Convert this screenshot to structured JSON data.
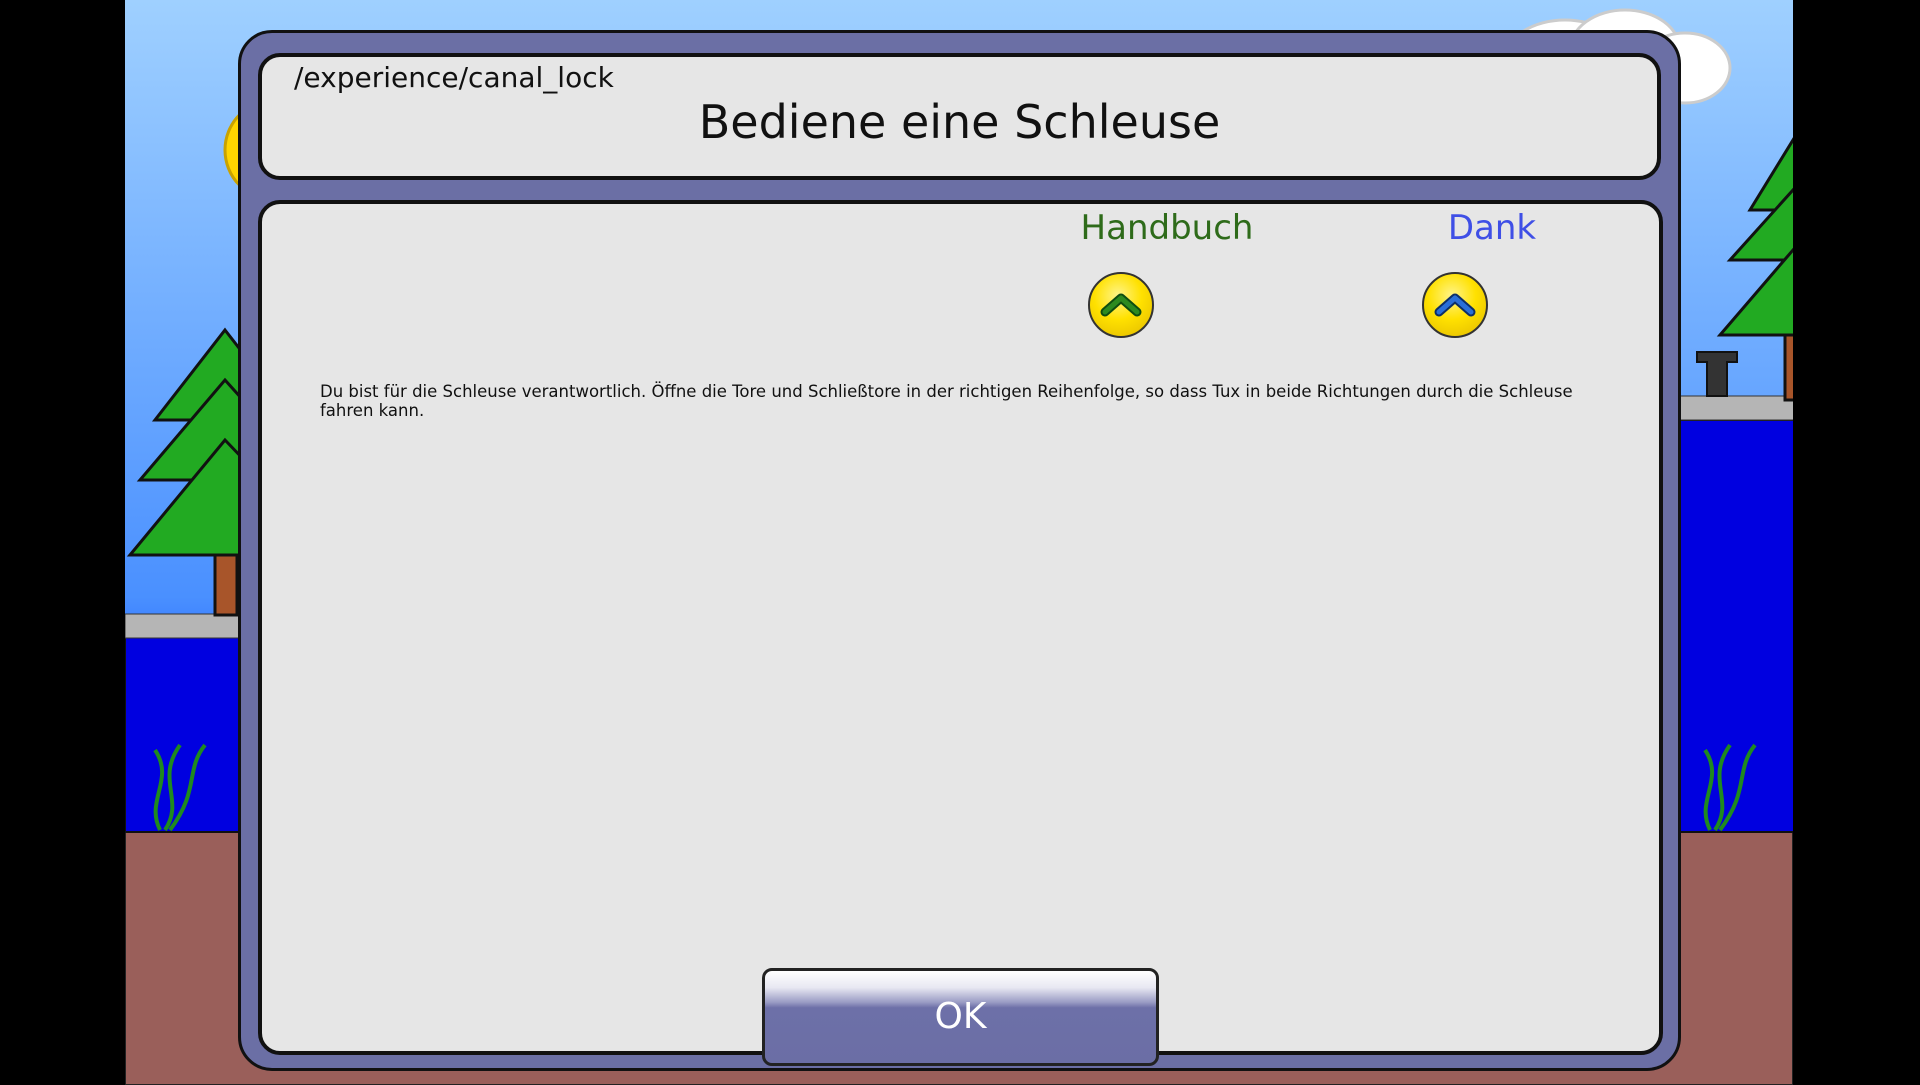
{
  "dialog": {
    "path": "/experience/canal_lock",
    "title": "Bediene eine Schleuse",
    "links": {
      "manual_label": "Handbuch",
      "credits_label": "Dank"
    },
    "description": "Du bist für die Schleuse verantwortlich. Öffne die Tore und Schließtore in der richtigen Reihenfolge, so dass Tux in beide Richtungen durch die Schleuse fahren kann.",
    "ok_label": "OK"
  },
  "icons": {
    "manual_button": "chevron-up-icon",
    "credits_button": "chevron-up-icon"
  },
  "colors": {
    "dialog_frame": "#6b6fa5",
    "panel_background": "#e6e6e6",
    "manual_link": "#2e6b1a",
    "credits_link": "#3f4fe6",
    "button_yellow": "#ffe100",
    "water": "#0000e0",
    "ground": "#9a5f5a"
  }
}
